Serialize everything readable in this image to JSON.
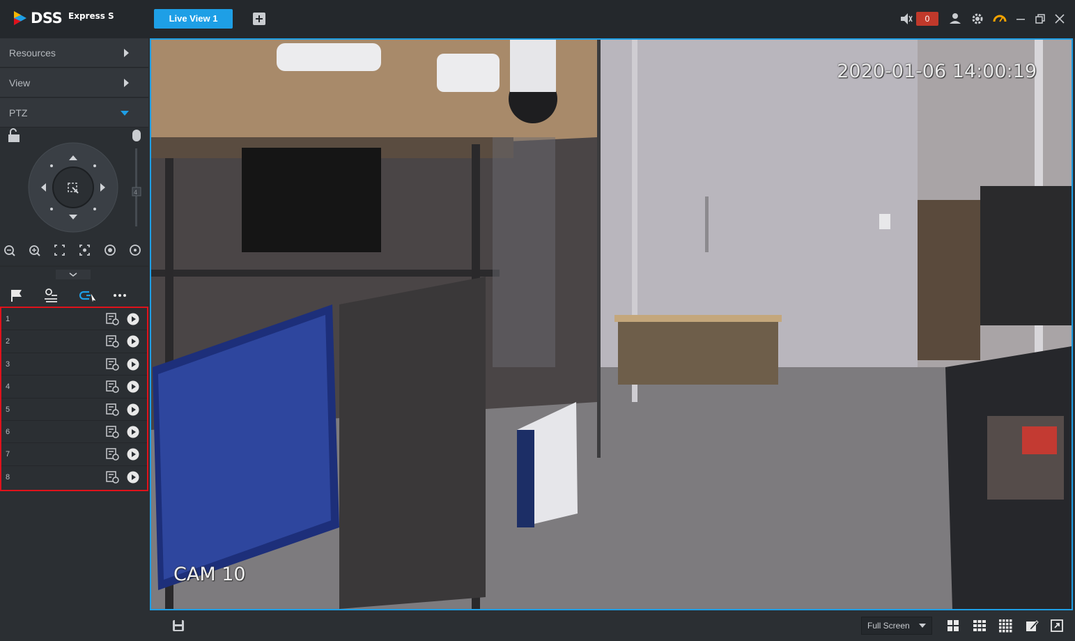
{
  "app": {
    "logo_name": "DSS",
    "logo_sub": "Express S"
  },
  "tabs": [
    {
      "label": "Live View 1",
      "active": true
    }
  ],
  "toolbar": {
    "alarm_count": "0",
    "icons": [
      "volume-icon",
      "user-icon",
      "settings-icon",
      "performance-icon",
      "minimize-icon",
      "restore-icon",
      "close-icon"
    ]
  },
  "sidebar": {
    "sections": [
      {
        "label": "Resources",
        "expanded": false
      },
      {
        "label": "View",
        "expanded": false
      },
      {
        "label": "PTZ",
        "expanded": true
      }
    ],
    "ptz_zoom_value": "4",
    "ptz_tabs": [
      "preset-icon",
      "tour-icon",
      "pattern-icon",
      "more-icon"
    ],
    "presets": [
      {
        "number": "1"
      },
      {
        "number": "2"
      },
      {
        "number": "3"
      },
      {
        "number": "4"
      },
      {
        "number": "5"
      },
      {
        "number": "6"
      },
      {
        "number": "7"
      },
      {
        "number": "8"
      }
    ]
  },
  "video": {
    "timestamp": "2020-01-06 14:00:19",
    "camera_label": "CAM 10"
  },
  "bottombar": {
    "screen_mode": "Full Screen",
    "layout_icons": [
      "layout-4-icon",
      "layout-9-icon",
      "layout-16-icon",
      "edit-icon",
      "fullscreen-icon"
    ]
  },
  "colors": {
    "accent": "#1e9fe6",
    "highlight_border": "#e0121b",
    "alarm": "#c0392b"
  }
}
